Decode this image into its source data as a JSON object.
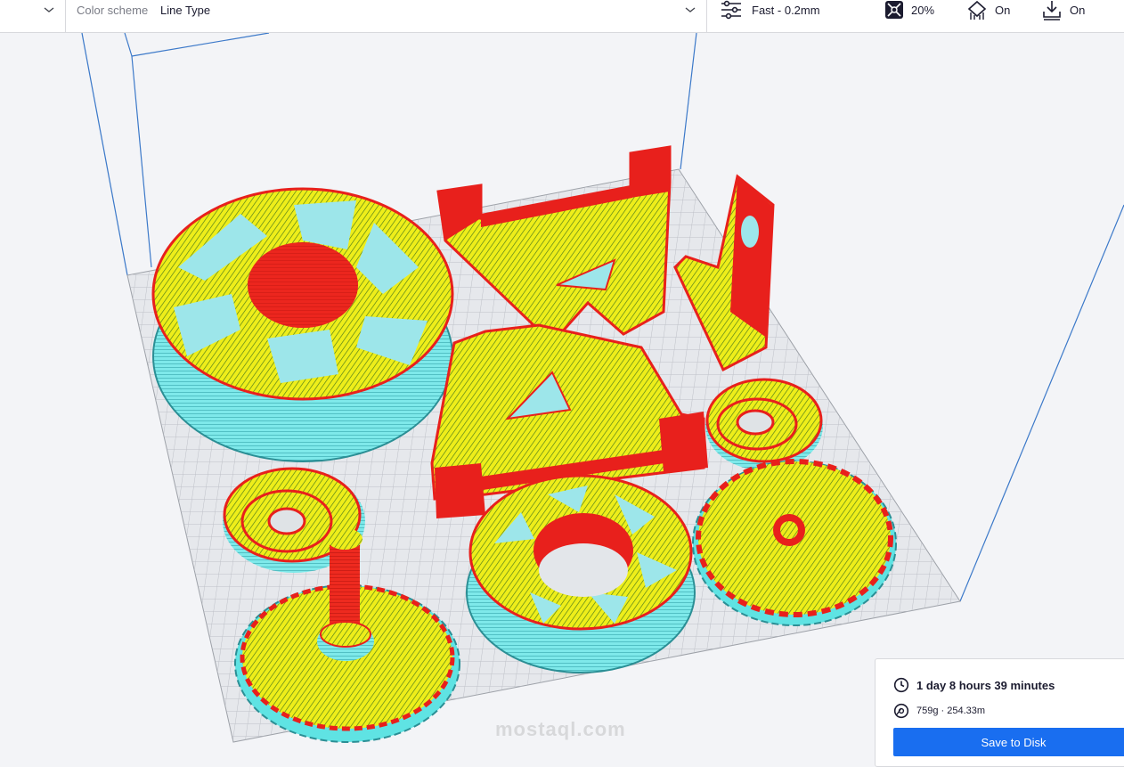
{
  "toolbar": {
    "color_scheme_label": "Color scheme",
    "color_scheme_value": "Line Type",
    "profile": "Fast - 0.2mm",
    "infill": "20%",
    "support": "On",
    "adhesion": "On"
  },
  "icons": {
    "profile": "sliders-icon",
    "infill": "infill-pattern-icon",
    "support": "support-icon",
    "adhesion": "adhesion-icon",
    "time": "clock-icon",
    "material": "spool-icon"
  },
  "print_info": {
    "time": "1 day 8 hours 39 minutes",
    "material": "759g · 254.33m",
    "save_button": "Save to Disk"
  },
  "watermark": "mostaql.com",
  "colors": {
    "wall_outer": "#e8201c",
    "wall_inner": "#f0ee1b",
    "skin": "#d9e81a",
    "support": "#5fe3e3",
    "primary_button": "#196ef0",
    "build_plate": "#ced1d6"
  }
}
